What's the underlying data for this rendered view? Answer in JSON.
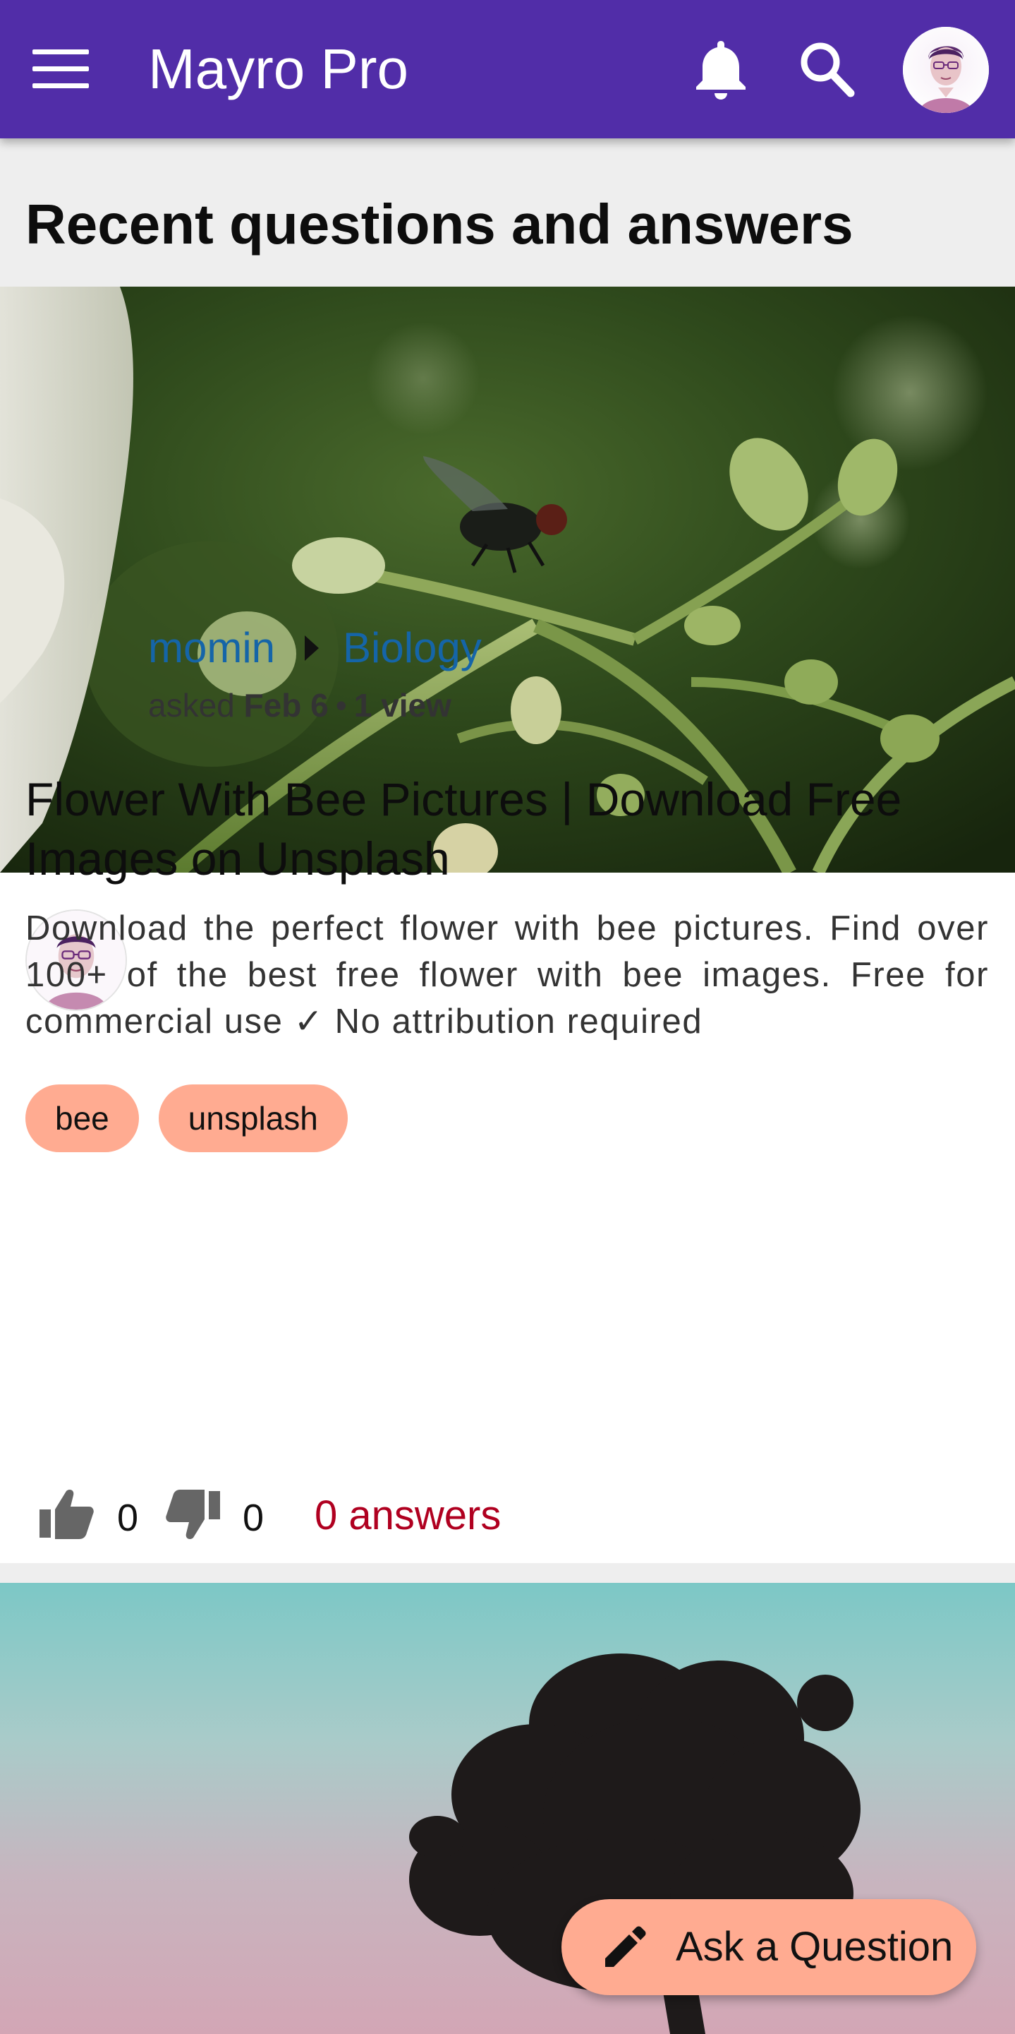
{
  "app_bar": {
    "title": "Mayro Pro",
    "background_color": "#512da8",
    "menu_icon": "hamburger-menu-icon",
    "notification_icon": "bell-icon",
    "search_icon": "search-icon",
    "account_icon": "user-avatar"
  },
  "section": {
    "title": "Recent questions and answers"
  },
  "question": {
    "author": "momin",
    "breadcrumb_icon": "chevron-right-icon",
    "category": "Biology",
    "asked_label": "asked",
    "date": "Feb 6",
    "separator": "•",
    "views": "1 view",
    "title": "Flower With Bee Pictures | Download Free Images on Unsplash",
    "excerpt": "Download the perfect flower with bee pictures. Find over 100+ of the best free flower with bee images. Free for commercial use ✓ No attribution required",
    "tags": [
      "bee",
      "unsplash"
    ],
    "upvotes": "0",
    "downvotes": "0",
    "answers": "0 answers",
    "upvote_icon": "thumb-up-icon",
    "downvote_icon": "thumb-down-icon"
  },
  "fab": {
    "label": "Ask a Question",
    "icon": "pencil-icon",
    "color": "#ffab91"
  },
  "colors": {
    "link": "#1565a8",
    "answers": "#b00020",
    "tag": "#ffab91",
    "page_background": "#eeeeee"
  }
}
